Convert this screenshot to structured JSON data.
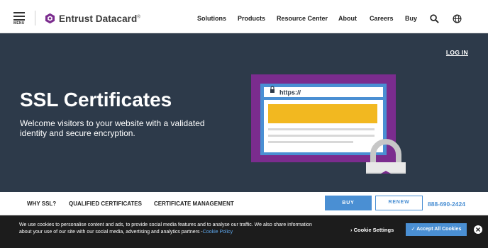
{
  "header": {
    "menu_label": "MENU",
    "logo_text": "Entrust Datacard",
    "logo_reg": "®",
    "nav": [
      {
        "label": "Solutions"
      },
      {
        "label": "Products"
      },
      {
        "label": "Resource Center"
      },
      {
        "label": "About"
      },
      {
        "label": "Careers"
      },
      {
        "label": "Buy"
      }
    ],
    "icons": [
      "search-icon",
      "globe-icon",
      "hamburger-menu-icon"
    ]
  },
  "hero": {
    "login": "LOG IN",
    "title": "SSL Certificates",
    "subtitle": "Welcome visitors to your website with a validated identity and secure encryption.",
    "browser_url": "https://",
    "illustration_icons": [
      "browser-window-icon",
      "padlock-icon"
    ]
  },
  "subnav": {
    "links": [
      {
        "label": "WHY SSL?"
      },
      {
        "label": "QUALIFIED CERTIFICATES"
      },
      {
        "label": "CERTIFICATE MANAGEMENT"
      }
    ],
    "buy": "BUY",
    "renew": "RENEW",
    "phone": "888-690-2424"
  },
  "cookie": {
    "text": "We use cookies to personalise content and ads, to provide social media features and to analyse our traffic. We also share information about your use of our site with our social media, advertising and analytics partners -",
    "link": "Cookie Policy",
    "settings": "Cookie Settings",
    "accept": "✓ Accept All Cookies"
  },
  "colors": {
    "hero_bg": "#2d3a4a",
    "brand_purple": "#7b2c8e",
    "accent_blue": "#4a8fd3",
    "banner_bg": "#1c1c1c",
    "yellow": "#f2b820"
  }
}
